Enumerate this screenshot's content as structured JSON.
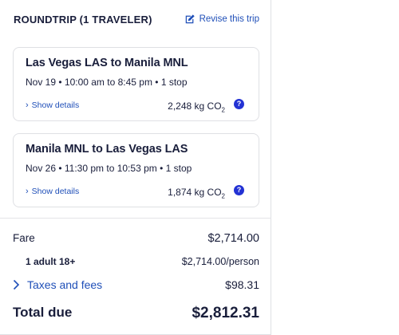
{
  "header": {
    "title": "ROUNDTRIP (1 TRAVELER)",
    "revise_label": "Revise this trip"
  },
  "flights": [
    {
      "route": "Las Vegas LAS to Manila MNL",
      "times": "Nov 19 • 10:00 am to 8:45 pm • 1 stop",
      "details_label": "Show details",
      "co2_value": "2,248 kg CO",
      "co2_sub": "2",
      "help": "?"
    },
    {
      "route": "Manila MNL to Las Vegas LAS",
      "times": "Nov 26 • 11:30 pm to 10:53 pm • 1 stop",
      "details_label": "Show details",
      "co2_value": "1,874 kg CO",
      "co2_sub": "2",
      "help": "?"
    }
  ],
  "pricing": {
    "fare_label": "Fare",
    "fare_value": "$2,714.00",
    "adult_label": "1 adult 18+",
    "adult_value": "$2,714.00/person",
    "taxes_label": "Taxes and fees",
    "taxes_value": "$98.31",
    "total_label": "Total due",
    "total_value": "$2,812.31"
  },
  "colors": {
    "text": "#191e3b",
    "link": "#1f4fb8",
    "help_badge": "#2332d4",
    "border": "#dfe0e4"
  },
  "icons": [
    "edit-icon",
    "chevron-right-icon",
    "help-icon"
  ]
}
